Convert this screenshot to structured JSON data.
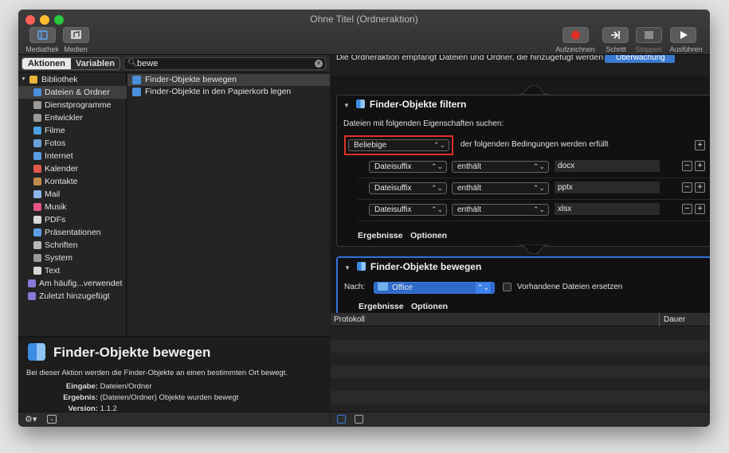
{
  "window": {
    "title": "Ohne Titel (Ordneraktion)"
  },
  "toolbar": {
    "left_buttons": [
      {
        "label": "Mediathek",
        "icon": "library-icon"
      },
      {
        "label": "Medien",
        "icon": "media-icon"
      }
    ],
    "right_buttons": [
      {
        "label": "Aufzeichnen",
        "icon": "record-icon"
      },
      {
        "label": "Schritt",
        "icon": "step-icon"
      },
      {
        "label": "Stoppen",
        "icon": "stop-icon"
      },
      {
        "label": "Ausführen",
        "icon": "run-icon"
      }
    ]
  },
  "left": {
    "tabs": [
      {
        "label": "Aktionen",
        "selected": true
      },
      {
        "label": "Variablen",
        "selected": false
      }
    ],
    "search": {
      "value": "bewe"
    },
    "library": [
      {
        "label": "Bibliothek",
        "level": 0,
        "selected": false,
        "color": "#e6b53a"
      },
      {
        "label": "Dateien & Ordner",
        "level": 1,
        "selected": true,
        "color": "#4a8fd9"
      },
      {
        "label": "Dienstprogramme",
        "level": 1,
        "selected": false,
        "color": "#9a9a9a"
      },
      {
        "label": "Entwickler",
        "level": 1,
        "selected": false,
        "color": "#9a9a9a"
      },
      {
        "label": "Filme",
        "level": 1,
        "selected": false,
        "color": "#4aa0e0"
      },
      {
        "label": "Fotos",
        "level": 1,
        "selected": false,
        "color": "#6aa0d8"
      },
      {
        "label": "Internet",
        "level": 1,
        "selected": false,
        "color": "#5b9de0"
      },
      {
        "label": "Kalender",
        "level": 1,
        "selected": false,
        "color": "#e0584a"
      },
      {
        "label": "Kontakte",
        "level": 1,
        "selected": false,
        "color": "#c08a4a"
      },
      {
        "label": "Mail",
        "level": 1,
        "selected": false,
        "color": "#8ab8e8"
      },
      {
        "label": "Musik",
        "level": 1,
        "selected": false,
        "color": "#e8548a"
      },
      {
        "label": "PDFs",
        "level": 1,
        "selected": false,
        "color": "#d8d8d8"
      },
      {
        "label": "Präsentationen",
        "level": 1,
        "selected": false,
        "color": "#5aa0e8"
      },
      {
        "label": "Schriften",
        "level": 1,
        "selected": false,
        "color": "#b8b8b8"
      },
      {
        "label": "System",
        "level": 1,
        "selected": false,
        "color": "#9a9a9a"
      },
      {
        "label": "Text",
        "level": 1,
        "selected": false,
        "color": "#d8d8d8"
      },
      {
        "label": "Am häufig...verwendet",
        "level": 0,
        "selected": false,
        "color": "#8a7ad8"
      },
      {
        "label": "Zuletzt hinzugefügt",
        "level": 0,
        "selected": false,
        "color": "#8a7ad8"
      }
    ],
    "actions": [
      {
        "label": "Finder-Objekte bewegen",
        "selected": true
      },
      {
        "label": "Finder-Objekte in den Papierkorb legen",
        "selected": false
      }
    ],
    "description": {
      "title": "Finder-Objekte bewegen",
      "text": "Bei dieser Aktion werden die Finder-Objekte an einen bestimmten Ort bewegt.",
      "rows": [
        {
          "key": "Eingabe:",
          "value": "Dateien/Ordner"
        },
        {
          "key": "Ergebnis:",
          "value": "(Dateien/Ordner) Objekte wurden bewegt"
        },
        {
          "key": "Version:",
          "value": "1.1.2"
        }
      ]
    }
  },
  "workflow": {
    "header_text": "Die Ordneraktion empfängt Dateien und Ordner, die hinzugefügt werden zu:",
    "header_folder": "Überwachung",
    "filter": {
      "title": "Finder-Objekte filtern",
      "subtitle": "Dateien mit folgenden Eigenschaften suchen:",
      "match": "Beliebige",
      "match_suffix": "der folgenden Bedingungen werden erfüllt",
      "conditions": [
        {
          "attr": "Dateisuffix",
          "op": "enthält",
          "value": "docx"
        },
        {
          "attr": "Dateisuffix",
          "op": "enthält",
          "value": "pptx"
        },
        {
          "attr": "Dateisuffix",
          "op": "enthält",
          "value": "xlsx"
        }
      ],
      "footer": [
        "Ergebnisse",
        "Optionen"
      ]
    },
    "move": {
      "title": "Finder-Objekte bewegen",
      "to_label": "Nach:",
      "folder": "Office",
      "replace_label": "Vorhandene Dateien ersetzen",
      "replace_checked": false,
      "footer": [
        "Ergebnisse",
        "Optionen"
      ]
    }
  },
  "log": {
    "col_log": "Protokoll",
    "col_duration": "Dauer"
  },
  "colors": {
    "accent": "#2e73d9",
    "highlight_box": "#e0302a",
    "record": "#e0302a"
  }
}
